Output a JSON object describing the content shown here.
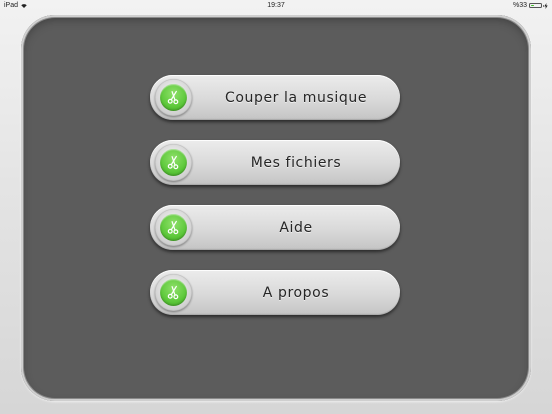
{
  "status_bar": {
    "device": "iPad",
    "time": "19:37",
    "battery_text": "%33",
    "battery_level_percent": 33,
    "icons": [
      "wifi-icon",
      "battery-icon",
      "charging-bolt-icon"
    ]
  },
  "menu": {
    "icon": "scissors-icon",
    "accent_color": "#5dc83a",
    "items": [
      {
        "label": "Couper la musique"
      },
      {
        "label": "Mes fichiers"
      },
      {
        "label": "Aide"
      },
      {
        "label": "A propos"
      }
    ]
  }
}
